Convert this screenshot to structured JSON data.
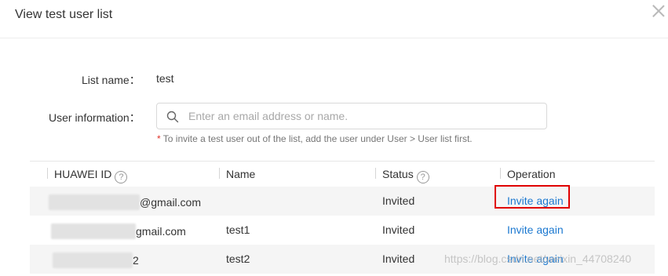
{
  "dialog": {
    "title": "View test user list"
  },
  "form": {
    "list_name_label": "List name：",
    "list_name_value": "test",
    "user_info_label": "User information：",
    "search_placeholder": "Enter an email address or name.",
    "hint_star": "*",
    "hint_text": " To invite a test user out of the list, add the user under User > User list first."
  },
  "table": {
    "columns": {
      "huawei_id": "HUAWEI ID",
      "name": "Name",
      "status": "Status",
      "operation": "Operation"
    },
    "help_glyph": "?",
    "rows": [
      {
        "id_visible": "@gmail.com",
        "name": "",
        "status": "Invited",
        "operation": "Invite again",
        "highlighted": true
      },
      {
        "id_visible": "gmail.com",
        "name": "test1",
        "status": "Invited",
        "operation": "Invite again",
        "highlighted": false
      },
      {
        "id_visible": "2",
        "name": "test2",
        "status": "Invited",
        "operation": "Invite again",
        "highlighted": false
      }
    ]
  },
  "watermark": "https://blog.csdn.net/weixin_44708240",
  "colors": {
    "link": "#1b78d0",
    "highlight_border": "#e00000",
    "required_star": "#e0332a"
  }
}
